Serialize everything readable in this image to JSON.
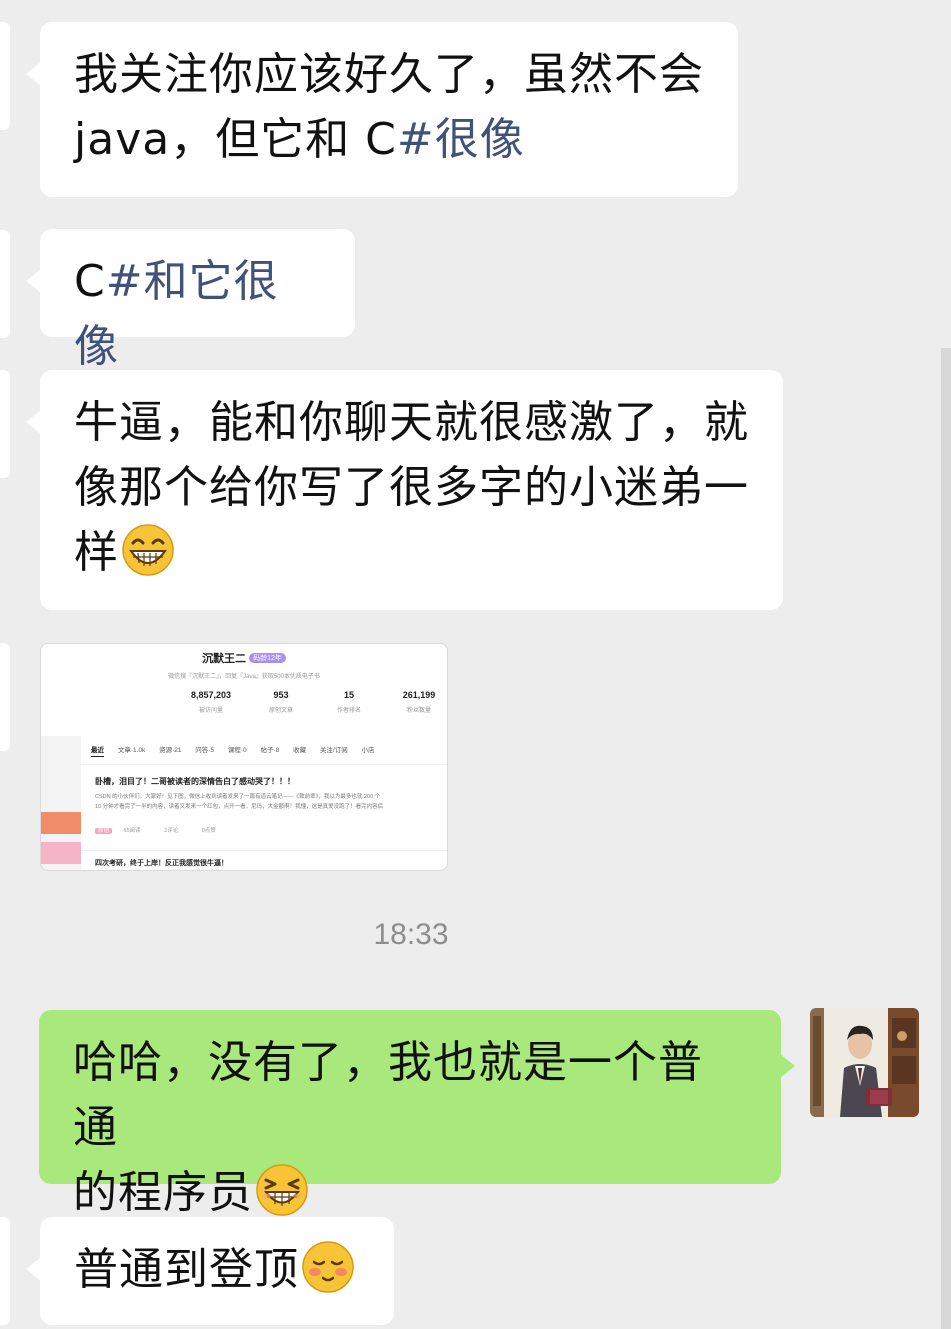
{
  "messages": [
    {
      "side": "left",
      "text_line1": "我关注你应该好久了，虽然不会",
      "text_line2_a": "java，但它和 C",
      "text_line2_b": "#很像"
    },
    {
      "side": "left",
      "text_a": "C",
      "text_b": "#和它很像"
    },
    {
      "side": "left",
      "text_line1": "牛逼，能和你聊天就很感激了，就",
      "text_line2": "像那个给你写了很多字的小迷弟一",
      "text_line3": "样",
      "emoji": "grinning-face-icon"
    },
    {
      "side": "left",
      "type": "image"
    },
    {
      "side": "right",
      "text_line1": "哈哈，没有了，我也就是一个普通",
      "text_line2": "的程序员",
      "emoji": "grin-squint-face-icon"
    },
    {
      "side": "left",
      "text": "普通到登顶",
      "emoji": "blushing-face-icon"
    }
  ],
  "timestamp": "18:33",
  "screenshot": {
    "blog_name": "沉默王二",
    "level_badge": "码龄12年",
    "subtitle": "微信搜『沉默王二』，回复『Java』获取500本优质电子书",
    "stats": [
      {
        "value": "8,857,203",
        "label": "被访问量"
      },
      {
        "value": "953",
        "label": "原创文章"
      },
      {
        "value": "15",
        "label": "作者排名"
      },
      {
        "value": "261,199",
        "label": "粉丝数量"
      }
    ],
    "tabs": [
      "最近",
      "文章·1.0k",
      "资源·21",
      "问答·5",
      "课程·0",
      "帖子·8",
      "收藏",
      "关注/订阅",
      "小店"
    ],
    "article_title": "卧槽，泪目了！二哥被读者的深情告白了感动哭了！！！",
    "article_body_1": "CSDN 的小伙伴们，大家好！见下图，微信上收到读者发来了一篇有道云笔记——《致前辈》，我以为最多也就 200 个",
    "article_body_2": "10 分钟才看完了一半的内容，读者又发来一个红包，点开一看，尼玛，大金额啊！我懂，这是真爱没跑了！看完内容后",
    "article_tag": "原创",
    "article_reads": "65阅读",
    "article_comments": "2评论",
    "article_likes": "0点赞",
    "article_title_2": "四次考研，终于上岸！反正我感觉很牛逼！"
  },
  "colors": {
    "background": "#ededed",
    "bubble_left": "#ffffff",
    "bubble_right": "#a9e97c",
    "hashtag_blue": "#40517a",
    "timestamp": "#8d8d8d"
  }
}
